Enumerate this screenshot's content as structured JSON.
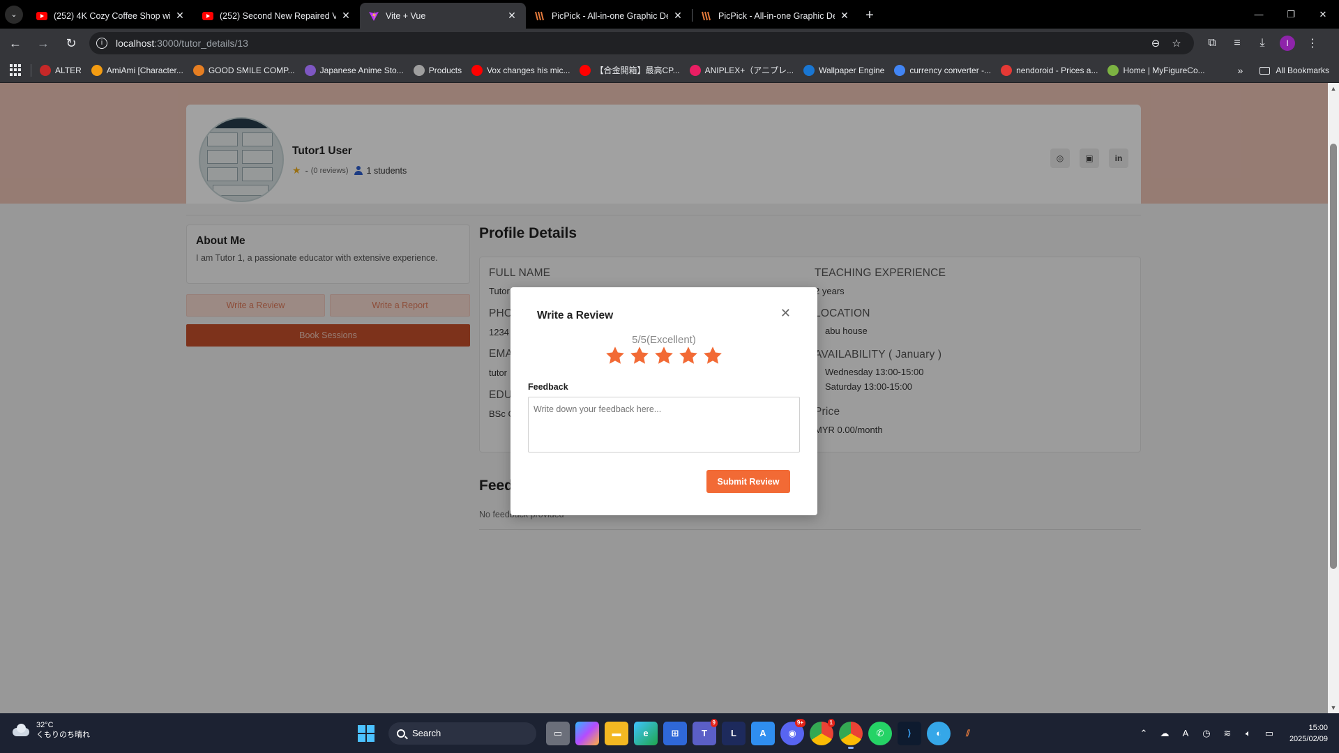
{
  "browser": {
    "tabs": [
      {
        "title": "(252) 4K Cozy Coffee Shop with",
        "icon": "youtube-icon",
        "active": false
      },
      {
        "title": "(252) Second New Repaired Ver",
        "icon": "youtube-icon",
        "active": false
      },
      {
        "title": "Vite + Vue",
        "icon": "vite-icon",
        "active": true
      },
      {
        "title": "PicPick - All-in-one Graphic De",
        "icon": "picpick-icon",
        "active": false
      },
      {
        "title": "PicPick - All-in-one Graphic De",
        "icon": "picpick-icon",
        "active": false
      }
    ],
    "url_host": "localhost",
    "url_path": ":3000/tutor_details/13",
    "profile_initial": "I",
    "bookmarks": [
      {
        "label": "ALTER",
        "color": "#c62828"
      },
      {
        "label": "AmiAmi [Character...",
        "color": "#f39c12"
      },
      {
        "label": "GOOD SMILE COMP...",
        "color": "#e67e22"
      },
      {
        "label": "Japanese Anime Sto...",
        "color": "#7e57c2"
      },
      {
        "label": "Products",
        "color": "#9e9e9e"
      },
      {
        "label": "Vox changes his mic...",
        "color": "#ff0000"
      },
      {
        "label": "【合金開箱】最高CP...",
        "color": "#ff0000"
      },
      {
        "label": "ANIPLEX+（アニプレ...",
        "color": "#e91e63"
      },
      {
        "label": "Wallpaper Engine",
        "color": "#1976d2"
      },
      {
        "label": "currency converter -...",
        "color": "#4285f4"
      },
      {
        "label": "nendoroid - Prices a...",
        "color": "#e53935"
      },
      {
        "label": "Home | MyFigureCo...",
        "color": "#7cb342"
      }
    ],
    "all_bookmarks": "All Bookmarks"
  },
  "tutor": {
    "name": "Tutor1 User",
    "rating": "-",
    "reviews": "(0 reviews)",
    "students": "1 students"
  },
  "about": {
    "title": "About Me",
    "text": "I am Tutor 1, a passionate educator with extensive experience."
  },
  "actions": {
    "write_review": "Write a Review",
    "write_report": "Write a Report",
    "book_sessions": "Book Sessions"
  },
  "details": {
    "title": "Profile Details",
    "full_name_label": "FULL NAME",
    "full_name_value": "Tutor",
    "phone_label": "PHO",
    "phone_value": "1234",
    "email_label": "EMA",
    "email_value": "tutor",
    "education_label": "EDU",
    "education_value": "BSc C",
    "experience_label": "TEACHING EXPERIENCE",
    "experience_value": "2 years",
    "location_label": "LOCATION",
    "location_value": "abu house",
    "availability_label": "AVAILABILITY ( January )",
    "availability": [
      "Wednesday 13:00-15:00",
      "Saturday 13:00-15:00"
    ],
    "price_label": "Price",
    "price_value": "MYR 0.00/month"
  },
  "feedback": {
    "title": "Feed",
    "empty": "No feedback provided"
  },
  "modal": {
    "title": "Write a Review",
    "rating_text": "5/5(Excellent)",
    "rating": 5,
    "max_rating": 5,
    "feedback_label": "Feedback",
    "feedback_placeholder": "Write down your feedback here...",
    "submit": "Submit Review",
    "star_color": "#f26a35"
  },
  "taskbar": {
    "temp": "32°C",
    "weather": "くもりのち晴れ",
    "search": "Search",
    "time": "15:00",
    "date": "2025/02/09",
    "badges": {
      "teams": "9",
      "discord": "9+",
      "chrome": "1"
    }
  }
}
